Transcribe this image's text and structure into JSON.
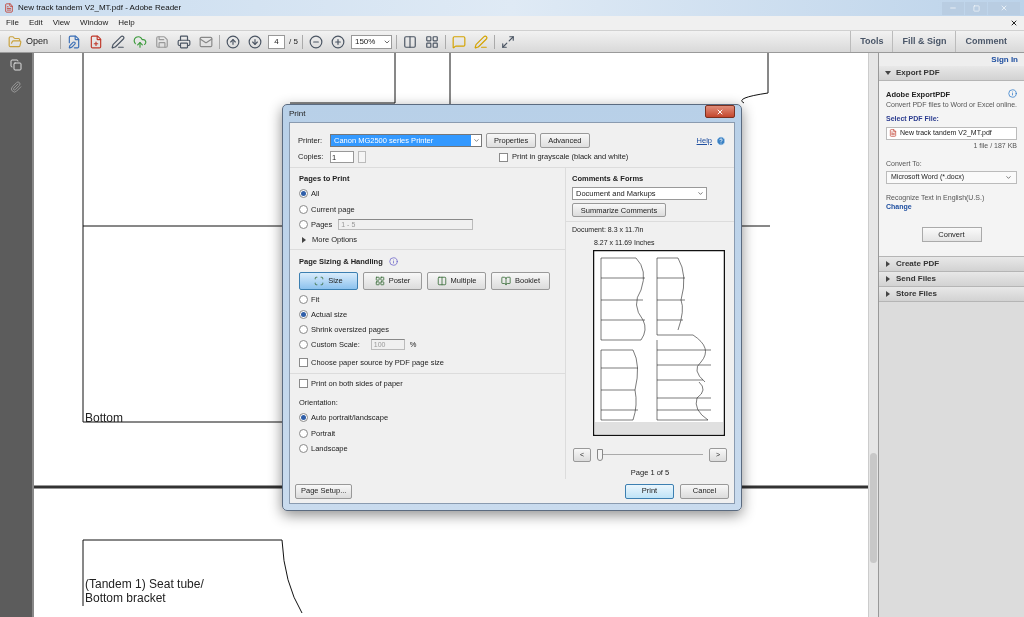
{
  "window": {
    "title": "New track tandem V2_MT.pdf - Adobe Reader"
  },
  "menu": [
    "File",
    "Edit",
    "View",
    "Window",
    "Help"
  ],
  "toolbar": {
    "open": "Open",
    "page": "4",
    "page_total": "/ 5",
    "zoom": "150%",
    "tabs": [
      {
        "label": "Tools",
        "selected": false
      },
      {
        "label": "Fill & Sign",
        "selected": false
      },
      {
        "label": "Comment",
        "selected": false
      }
    ]
  },
  "document": {
    "captions": [
      "Bottom",
      "(Tandem 1) Seat tube/ Bottom bracket"
    ]
  },
  "dialog": {
    "title": "Print",
    "printer_label": "Printer:",
    "printer": "Canon MG2500 series Printer",
    "properties": "Properties",
    "advanced": "Advanced",
    "help": "Help",
    "copies_label": "Copies:",
    "copies": "1",
    "grayscale": {
      "label": "Print in grayscale (black and white)",
      "checked": false
    },
    "pages_to_print": {
      "heading": "Pages to Print",
      "options": [
        {
          "label": "All",
          "selected": true
        },
        {
          "label": "Current page",
          "selected": false
        },
        {
          "label": "Pages",
          "selected": false,
          "value": "1 - 5"
        }
      ],
      "more_options": "More Options"
    },
    "sizing": {
      "heading": "Page Sizing & Handling",
      "modes": [
        {
          "label": "Size",
          "selected": true
        },
        {
          "label": "Poster",
          "selected": false
        },
        {
          "label": "Multiple",
          "selected": false
        },
        {
          "label": "Booklet",
          "selected": false
        }
      ],
      "options": [
        {
          "label": "Fit",
          "selected": false
        },
        {
          "label": "Actual size",
          "selected": true
        },
        {
          "label": "Shrink oversized pages",
          "selected": false
        },
        {
          "label": "Custom Scale:",
          "selected": false,
          "value": "100",
          "unit": "%"
        }
      ],
      "paper_source": {
        "label": "Choose paper source by PDF page size",
        "checked": false
      }
    },
    "both_sides": {
      "label": "Print on both sides of paper",
      "checked": false
    },
    "orientation": {
      "heading": "Orientation:",
      "options": [
        {
          "label": "Auto portrait/landscape",
          "selected": true
        },
        {
          "label": "Portrait",
          "selected": false
        },
        {
          "label": "Landscape",
          "selected": false
        }
      ]
    },
    "comments": {
      "heading": "Comments & Forms",
      "value": "Document and Markups",
      "summarize": "Summarize Comments"
    },
    "preview": {
      "document": "Document: 8.3 x 11.7in",
      "size": "8.27 x 11.69 Inches",
      "prev": "<",
      "next": ">",
      "page": "Page 1 of 5",
      "level": 0
    },
    "page_setup": "Page Setup...",
    "print": "Print",
    "cancel": "Cancel"
  },
  "right_pane": {
    "sign_in": "Sign In",
    "sections": [
      {
        "title": "Export PDF",
        "expanded": true
      },
      {
        "title": "Create PDF",
        "expanded": false
      },
      {
        "title": "Send Files",
        "expanded": false
      },
      {
        "title": "Store Files",
        "expanded": false
      }
    ],
    "export": {
      "heading": "Adobe ExportPDF",
      "description": "Convert PDF files to Word or Excel online.",
      "select_label": "Select PDF File:",
      "file": "New track tandem V2_MT.pdf",
      "file_info": "1 file / 187 KB",
      "convert_to_label": "Convert To:",
      "convert_to": "Microsoft Word (*.docx)",
      "recognize": "Recognize Text in English(U.S.)",
      "change": "Change",
      "convert": "Convert"
    }
  }
}
